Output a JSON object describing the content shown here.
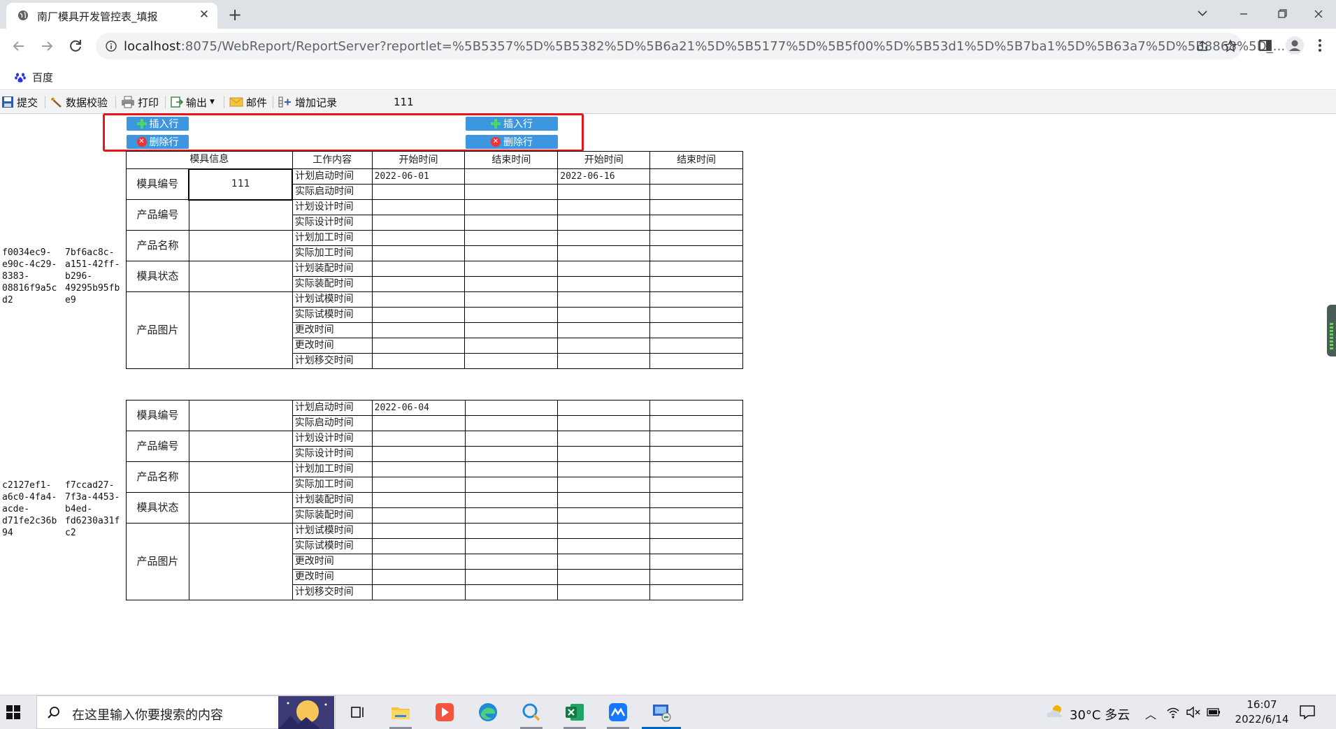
{
  "browser": {
    "tab_title": "南厂模具开发管控表_填报",
    "url_host": "localhost",
    "url_rest": ":8075/WebReport/ReportServer?reportlet=%5B5357%5D%5B5382%5D%5B6a21%5D%5B5177%5D%5B5f00%5D%5B53d1%5D%5B7ba1%5D%5B63a7%5D%5B8868%5D_...",
    "bookmark": "百度"
  },
  "toolbar": {
    "submit": "提交",
    "validate": "数据校验",
    "print": "打印",
    "export": "输出",
    "mail": "邮件",
    "add_record": "增加记录",
    "value": "111"
  },
  "buttons": {
    "insert_row": "插入行",
    "delete_row": "删除行"
  },
  "table": {
    "headers": [
      "模具信息",
      "工作内容",
      "开始时间",
      "结束时间",
      "开始时间",
      "结束时间"
    ],
    "info_labels": [
      "模具编号",
      "产品编号",
      "产品名称",
      "模具状态",
      "产品图片"
    ],
    "work_items": [
      "计划启动时间",
      "实际启动时间",
      "计划设计时间",
      "实际设计时间",
      "计划加工时间",
      "实际加工时间",
      "计划装配时间",
      "实际装配时间",
      "计划试模时间",
      "实际试模时间",
      "更改时间",
      "更改时间",
      "计划移交时间"
    ]
  },
  "records": [
    {
      "id1": "f0034ec9-\ne90c-4c29-\n8383-\n08816f9a5c\nd2",
      "id2": "7bf6ac8c-\na151-42ff-\nb296-\n49295b95fb\ne9",
      "mold_no": "111",
      "start1": "2022-06-01",
      "start2": "2022-06-16"
    },
    {
      "id1": "c2127ef1-\na6c0-4fa4-\nacde-\nd71fe2c36b\n94",
      "id2": "f7ccad27-\n7f3a-4453-\nb4ed-\nfd6230a31f\nc2",
      "mold_no": "",
      "start1": "2022-06-04",
      "start2": ""
    }
  ],
  "taskbar": {
    "search_placeholder": "在这里输入你要搜索的内容",
    "weather": "30°C  多云",
    "time": "16:07",
    "date": "2022/6/14"
  }
}
